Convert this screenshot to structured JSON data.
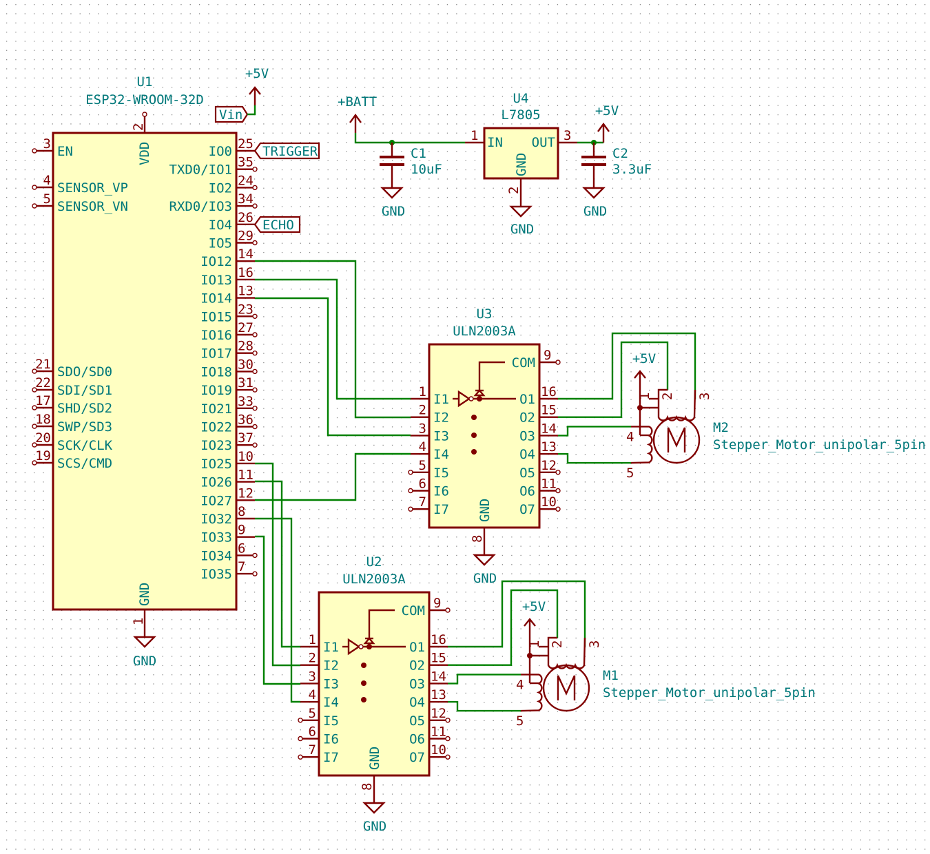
{
  "colors": {
    "symbol": "#800000",
    "symbol_fill": "#ffffc2",
    "wire": "#008000",
    "text": "#00787a",
    "grid": "#8c8c8c"
  },
  "u1": {
    "ref": "U1",
    "value": "ESP32-WROOM-32D",
    "vdd_pin": "2",
    "vdd_name": "VDD",
    "gnd_pin": "1",
    "gnd_name": "GND",
    "left_pins": [
      {
        "num": "3",
        "name": "EN"
      },
      {
        "num": "4",
        "name": "SENSOR_VP"
      },
      {
        "num": "5",
        "name": "SENSOR_VN"
      },
      {
        "num": "21",
        "name": "SDO/SD0"
      },
      {
        "num": "22",
        "name": "SDI/SD1"
      },
      {
        "num": "17",
        "name": "SHD/SD2"
      },
      {
        "num": "18",
        "name": "SWP/SD3"
      },
      {
        "num": "20",
        "name": "SCK/CLK"
      },
      {
        "num": "19",
        "name": "SCS/CMD"
      }
    ],
    "right_pins": [
      {
        "num": "25",
        "name": "IO0"
      },
      {
        "num": "35",
        "name": "TXD0/IO1"
      },
      {
        "num": "24",
        "name": "IO2"
      },
      {
        "num": "34",
        "name": "RXD0/IO3"
      },
      {
        "num": "26",
        "name": "IO4"
      },
      {
        "num": "29",
        "name": "IO5"
      },
      {
        "num": "14",
        "name": "IO12"
      },
      {
        "num": "16",
        "name": "IO13"
      },
      {
        "num": "13",
        "name": "IO14"
      },
      {
        "num": "23",
        "name": "IO15"
      },
      {
        "num": "27",
        "name": "IO16"
      },
      {
        "num": "28",
        "name": "IO17"
      },
      {
        "num": "30",
        "name": "IO18"
      },
      {
        "num": "31",
        "name": "IO19"
      },
      {
        "num": "33",
        "name": "IO21"
      },
      {
        "num": "36",
        "name": "IO22"
      },
      {
        "num": "37",
        "name": "IO23"
      },
      {
        "num": "10",
        "name": "IO25"
      },
      {
        "num": "11",
        "name": "IO26"
      },
      {
        "num": "12",
        "name": "IO27"
      },
      {
        "num": "8",
        "name": "IO32"
      },
      {
        "num": "9",
        "name": "IO33"
      },
      {
        "num": "6",
        "name": "IO34"
      },
      {
        "num": "7",
        "name": "IO35"
      }
    ]
  },
  "labels": {
    "trigger": "TRIGGER",
    "echo": "ECHO",
    "vin": "Vin"
  },
  "power": {
    "p5v": "+5V",
    "batt": "+BATT",
    "gnd": "GND"
  },
  "u4": {
    "ref": "U4",
    "value": "L7805",
    "in_name": "IN",
    "out_name": "OUT",
    "gnd_name": "GND",
    "in_pin": "1",
    "gnd_pin": "2",
    "out_pin": "3"
  },
  "c1": {
    "ref": "C1",
    "value": "10uF"
  },
  "c2": {
    "ref": "C2",
    "value": "3.3uF"
  },
  "u3": {
    "ref": "U3",
    "value": "ULN2003A",
    "com_name": "COM",
    "com_pin": "9",
    "gnd_name": "GND",
    "gnd_pin": "8",
    "inputs": [
      {
        "num": "1",
        "name": "I1"
      },
      {
        "num": "2",
        "name": "I2"
      },
      {
        "num": "3",
        "name": "I3"
      },
      {
        "num": "4",
        "name": "I4"
      },
      {
        "num": "5",
        "name": "I5"
      },
      {
        "num": "6",
        "name": "I6"
      },
      {
        "num": "7",
        "name": "I7"
      }
    ],
    "outputs": [
      {
        "num": "16",
        "name": "O1"
      },
      {
        "num": "15",
        "name": "O2"
      },
      {
        "num": "14",
        "name": "O3"
      },
      {
        "num": "13",
        "name": "O4"
      },
      {
        "num": "12",
        "name": "O5"
      },
      {
        "num": "11",
        "name": "O6"
      },
      {
        "num": "10",
        "name": "O7"
      }
    ]
  },
  "u2": {
    "ref": "U2",
    "value": "ULN2003A",
    "com_name": "COM",
    "com_pin": "9",
    "gnd_name": "GND",
    "gnd_pin": "8",
    "inputs": [
      {
        "num": "1",
        "name": "I1"
      },
      {
        "num": "2",
        "name": "I2"
      },
      {
        "num": "3",
        "name": "I3"
      },
      {
        "num": "4",
        "name": "I4"
      },
      {
        "num": "5",
        "name": "I5"
      },
      {
        "num": "6",
        "name": "I6"
      },
      {
        "num": "7",
        "name": "I7"
      }
    ],
    "outputs": [
      {
        "num": "16",
        "name": "O1"
      },
      {
        "num": "15",
        "name": "O2"
      },
      {
        "num": "14",
        "name": "O3"
      },
      {
        "num": "13",
        "name": "O4"
      },
      {
        "num": "12",
        "name": "O5"
      },
      {
        "num": "11",
        "name": "O6"
      },
      {
        "num": "10",
        "name": "O7"
      }
    ]
  },
  "m2": {
    "ref": "M2",
    "value": "Stepper_Motor_unipolar_5pin",
    "pins": [
      "1",
      "2",
      "3",
      "4",
      "5"
    ],
    "glyph": "M"
  },
  "m1": {
    "ref": "M1",
    "value": "Stepper_Motor_unipolar_5pin",
    "pins": [
      "1",
      "2",
      "3",
      "4",
      "5"
    ],
    "glyph": "M"
  },
  "connections": [
    {
      "from": "U1.IO12",
      "to": "U3.I2"
    },
    {
      "from": "U1.IO13",
      "to": "U3.I1"
    },
    {
      "from": "U1.IO14",
      "to": "U3.I3"
    },
    {
      "from": "U1.IO27",
      "to": "U3.I4"
    },
    {
      "from": "U1.IO25",
      "to": "U2.I2"
    },
    {
      "from": "U1.IO26",
      "to": "U2.I1"
    },
    {
      "from": "U1.IO32",
      "to": "U2.I4"
    },
    {
      "from": "U1.IO33",
      "to": "U2.I3"
    },
    {
      "from": "U1.IO0",
      "to": "TRIGGER"
    },
    {
      "from": "U1.IO4",
      "to": "ECHO"
    },
    {
      "from": "Vin",
      "to": "+5V"
    },
    {
      "from": "+BATT",
      "to": "U4.IN"
    },
    {
      "from": "U4.OUT",
      "to": "+5V"
    }
  ]
}
